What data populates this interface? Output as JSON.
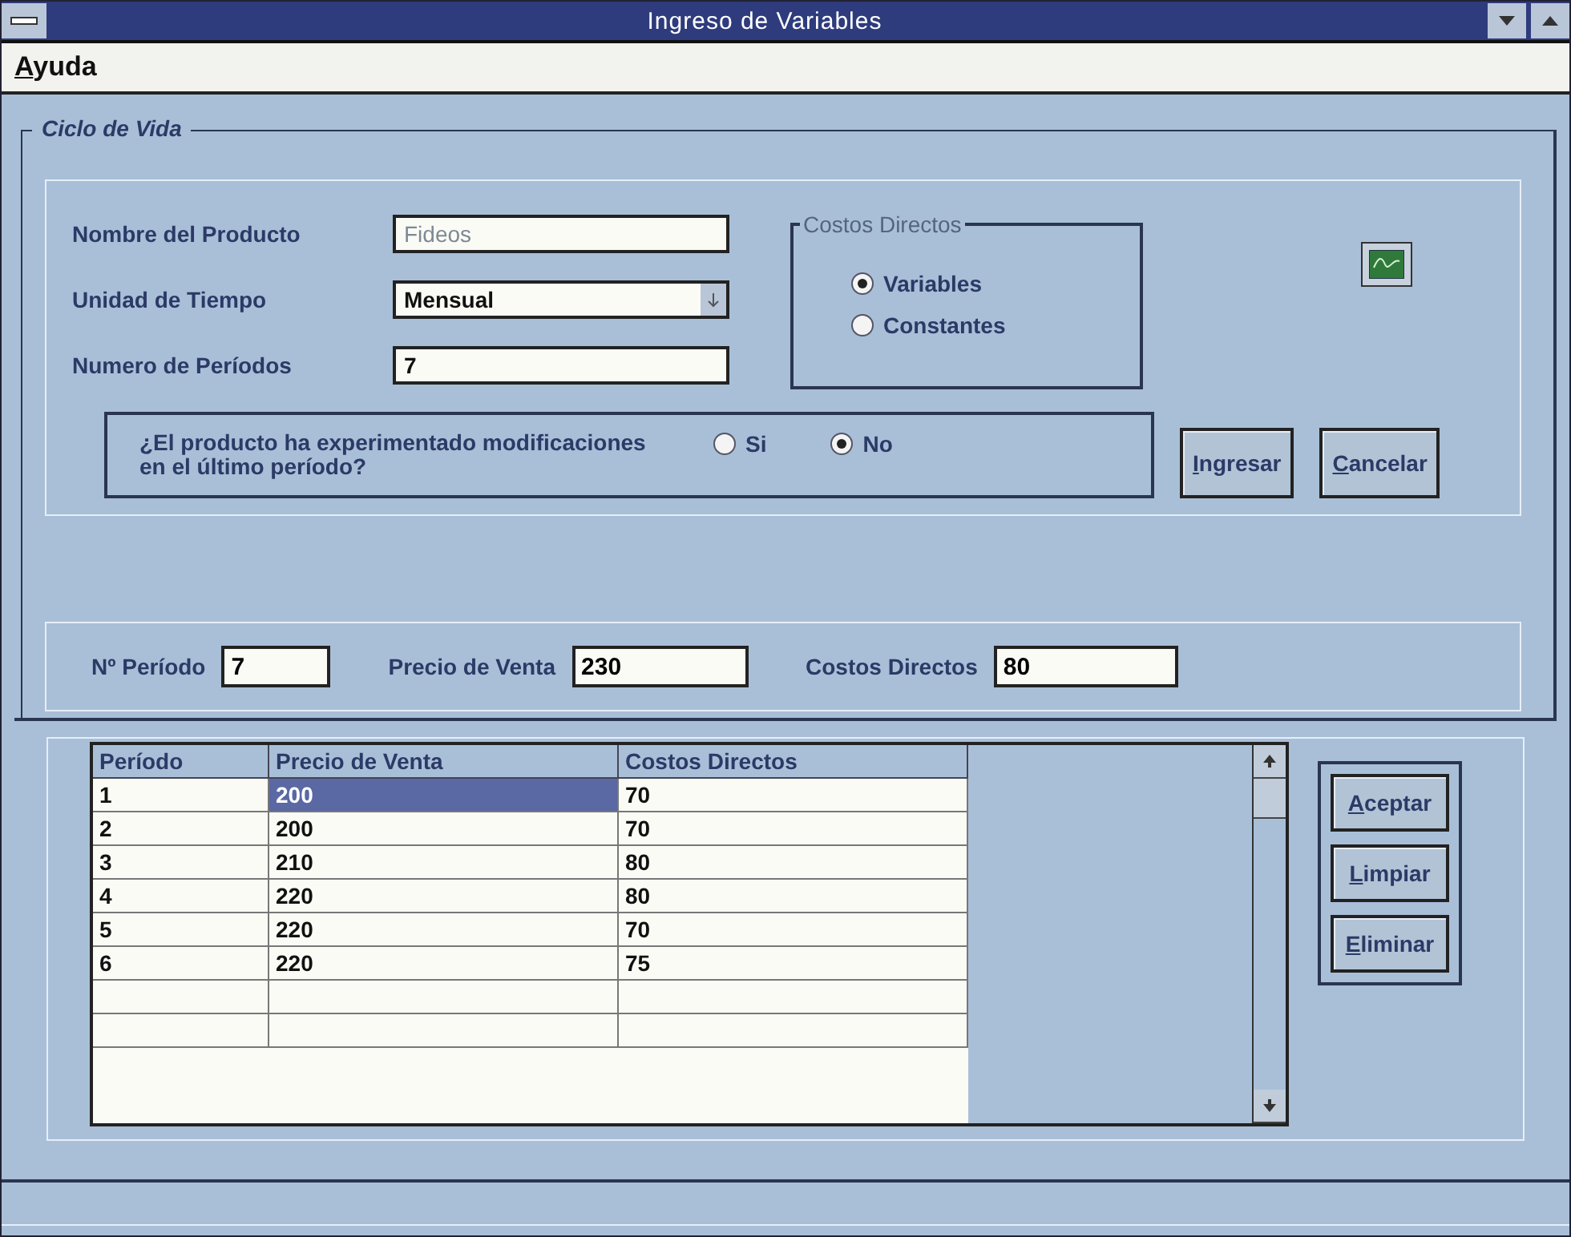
{
  "window": {
    "title": "Ingreso de Variables"
  },
  "menu": [
    "Ayuda"
  ],
  "group": {
    "title": "Ciclo de Vida"
  },
  "fields": [
    {
      "label": "Nombre del Producto",
      "value": "Fideos",
      "kind": "text",
      "disabled": true
    },
    {
      "label": "Unidad de Tiempo",
      "value": "Mensual",
      "kind": "combo",
      "disabled": false
    },
    {
      "label": "Numero de Períodos",
      "value": "7",
      "kind": "text",
      "disabled": false
    }
  ],
  "costos_directos": {
    "title": "Costos Directos",
    "options": [
      {
        "label": "Variables",
        "selected": true
      },
      {
        "label": "Constantes",
        "selected": false
      }
    ]
  },
  "question": {
    "text": "¿El producto ha experimentado modificaciones en el último período?",
    "options": [
      {
        "label": "Si",
        "selected": false
      },
      {
        "label": "No",
        "selected": true
      }
    ]
  },
  "actions": [
    "Ingresar",
    "Cancelar"
  ],
  "entry": [
    {
      "label": "Nº Período",
      "value": "7"
    },
    {
      "label": "Precio de Venta",
      "value": "230"
    },
    {
      "label": "Costos Directos",
      "value": "80"
    }
  ],
  "table": {
    "columns": [
      "Período",
      "Precio de Venta",
      "Costos Directos"
    ],
    "rows": [
      {
        "cells": [
          {
            "text": "1",
            "selected": false
          },
          {
            "text": "200",
            "selected": true
          },
          {
            "text": "70",
            "selected": false
          }
        ]
      },
      {
        "cells": [
          {
            "text": "2",
            "selected": false
          },
          {
            "text": "200",
            "selected": false
          },
          {
            "text": "70",
            "selected": false
          }
        ]
      },
      {
        "cells": [
          {
            "text": "3",
            "selected": false
          },
          {
            "text": "210",
            "selected": false
          },
          {
            "text": "80",
            "selected": false
          }
        ]
      },
      {
        "cells": [
          {
            "text": "4",
            "selected": false
          },
          {
            "text": "220",
            "selected": false
          },
          {
            "text": "80",
            "selected": false
          }
        ]
      },
      {
        "cells": [
          {
            "text": "5",
            "selected": false
          },
          {
            "text": "220",
            "selected": false
          },
          {
            "text": "70",
            "selected": false
          }
        ]
      },
      {
        "cells": [
          {
            "text": "6",
            "selected": false
          },
          {
            "text": "220",
            "selected": false
          },
          {
            "text": "75",
            "selected": false
          }
        ]
      }
    ]
  },
  "table_buttons": [
    "Aceptar",
    "Limpiar",
    "Eliminar"
  ]
}
